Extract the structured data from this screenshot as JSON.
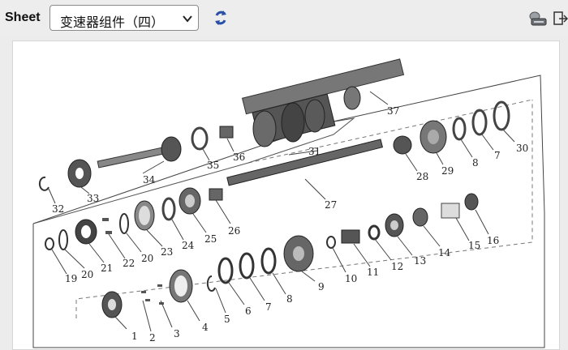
{
  "toolbar": {
    "sheet_label": "Sheet",
    "sheet_select_value": "变速器组件（四）",
    "refresh_icon": "refresh-icon",
    "print_icon": "print-icon",
    "exit_icon": "exit-icon"
  },
  "diagram": {
    "part_numbers": [
      "1",
      "2",
      "3",
      "4",
      "5",
      "6",
      "7",
      "8",
      "9",
      "10",
      "11",
      "12",
      "13",
      "14",
      "15",
      "16",
      "19",
      "20",
      "21",
      "22",
      "20",
      "23",
      "24",
      "25",
      "26",
      "27",
      "28",
      "29",
      "8",
      "7",
      "30",
      "31",
      "32",
      "33",
      "34",
      "35",
      "36",
      "37"
    ]
  },
  "colors": {
    "accent": "#2a4fa8",
    "canvas": "#ffffff",
    "toolbar": "#ededed"
  }
}
